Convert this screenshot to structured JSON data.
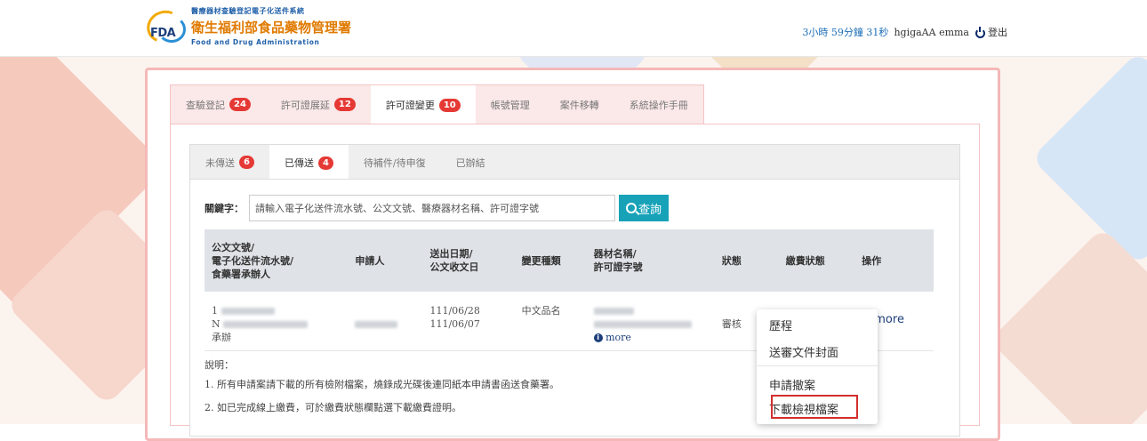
{
  "header": {
    "logo_line1": "醫療器材查驗登記電子化送件系統",
    "logo_line2": "衛生福利部食品藥物管理署",
    "logo_line3": "Food and Drug Administration",
    "logo_fda": "FDA",
    "timer": "3小時 59分鐘 31秒",
    "user": "hgigaAA emma",
    "logout": "登出"
  },
  "main_tabs": [
    {
      "label": "查驗登記",
      "badge": "24",
      "active": false
    },
    {
      "label": "許可證展延",
      "badge": "12",
      "active": false
    },
    {
      "label": "許可證變更",
      "badge": "10",
      "active": true
    },
    {
      "label": "帳號管理",
      "badge": "",
      "active": false
    },
    {
      "label": "案件移轉",
      "badge": "",
      "active": false
    },
    {
      "label": "系統操作手冊",
      "badge": "",
      "active": false
    }
  ],
  "sub_tabs": [
    {
      "label": "未傳送",
      "badge": "6",
      "active": false
    },
    {
      "label": "已傳送",
      "badge": "4",
      "active": true
    },
    {
      "label": "待補件/待申復",
      "badge": "",
      "active": false
    },
    {
      "label": "已辦結",
      "badge": "",
      "active": false
    }
  ],
  "search": {
    "label": "關鍵字：",
    "placeholder": "請輸入電子化送件流水號、公文文號、醫療器材名稱、許可證字號",
    "button": "查詢"
  },
  "table": {
    "headers": {
      "doc_l1": "公文文號/",
      "doc_l2": "電子化送件流水號/",
      "doc_l3": "食藥署承辦人",
      "applicant": "申請人",
      "date_l1": "送出日期/",
      "date_l2": "公文收文日",
      "change_type": "變更種類",
      "device_l1": "器材名稱/",
      "device_l2": "許可證字號",
      "status": "狀態",
      "payment": "繳費狀態",
      "action": "操作"
    },
    "row": {
      "doc_prefix1": "1",
      "doc_prefix2": "N",
      "handler": "承辦",
      "send_date": "111/06/28",
      "receive_date": "111/06/07",
      "change_type": "中文品名",
      "device_more": "more",
      "status": "審核",
      "action_more": "more"
    }
  },
  "notes": {
    "title": "說明：",
    "line1": "1. 所有申請案請下載的所有檢附檔案，燒錄成光碟後連同紙本申請書函送食藥署。",
    "line2": "2. 如已完成線上繳費，可於繳費狀態欄點選下載繳費證明。"
  },
  "dropdown": {
    "items": [
      "歷程",
      "送審文件封面",
      "申請撤案",
      "下載檢視檔案"
    ]
  },
  "colors": {
    "badge": "#e53935",
    "search_button": "#17a2b8",
    "highlight": "#d32f2f",
    "link": "#1d3f7a"
  }
}
